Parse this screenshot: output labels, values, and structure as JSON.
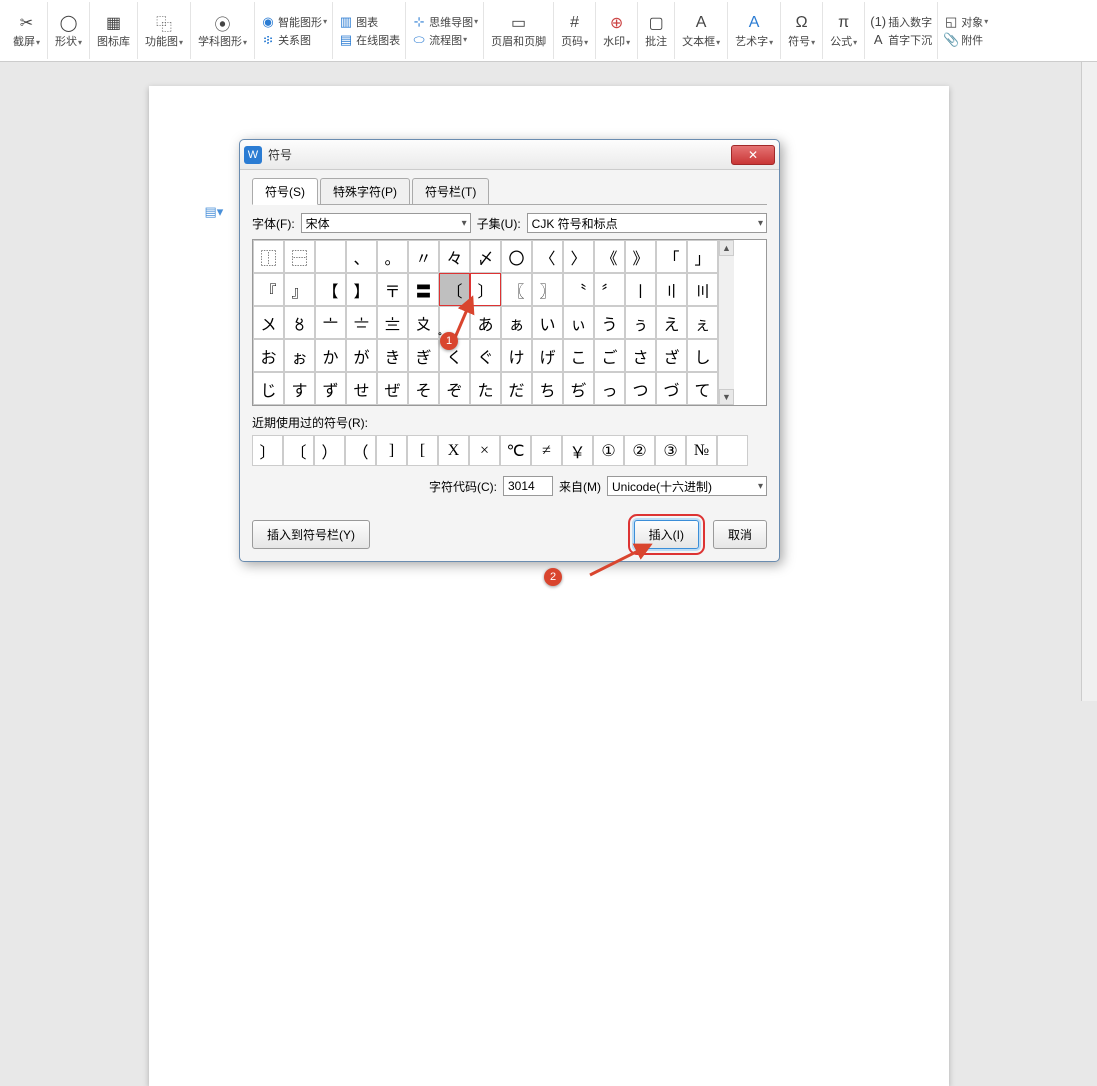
{
  "ribbon": {
    "screenshot": "截屏",
    "shape": "形状",
    "iconlib": "图标库",
    "funcimg": "功能图",
    "subjimg": "学科图形",
    "smartart": "智能图形",
    "chart": "图表",
    "relation": "关系图",
    "mindmap": "思维导图",
    "onlinechart": "在线图表",
    "flowchart": "流程图",
    "headerfooter": "页眉和页脚",
    "pagenum": "页码",
    "watermark": "水印",
    "comment": "批注",
    "textbox": "文本框",
    "wordart": "艺术字",
    "symbol": "符号",
    "equation": "公式",
    "insnum": "插入数字",
    "object": "对象",
    "dropcap": "首字下沉",
    "attach": "附件"
  },
  "dialog": {
    "title": "符号",
    "tabs": {
      "sym": "符号(S)",
      "special": "特殊字符(P)",
      "bar": "符号栏(T)"
    },
    "font_lbl": "字体(F):",
    "font_val": "宋体",
    "subset_lbl": "子集(U):",
    "subset_val": "CJK 符号和标点",
    "grid": [
      [
        "⿰",
        "⿱",
        "",
        "、",
        "。",
        "〃",
        "々",
        "〆",
        "〇",
        "〈",
        "〉",
        "《",
        "》",
        "「",
        "」"
      ],
      [
        "『",
        "』",
        "【",
        "】",
        "〒",
        "〓",
        "〔",
        "〕",
        "〖",
        "〗",
        "〝",
        "〞",
        "〡",
        "〢",
        "〣"
      ],
      [
        "〤",
        "〥",
        "〦",
        "〧",
        "〨",
        "〩",
        "〪",
        "あ",
        "ぁ",
        "い",
        "ぃ",
        "う",
        "ぅ",
        "え",
        "ぇ"
      ],
      [
        "お",
        "ぉ",
        "か",
        "が",
        "き",
        "ぎ",
        "く",
        "ぐ",
        "け",
        "げ",
        "こ",
        "ご",
        "さ",
        "ざ",
        "し"
      ],
      [
        "じ",
        "す",
        "ず",
        "せ",
        "ぜ",
        "そ",
        "ぞ",
        "た",
        "だ",
        "ち",
        "ぢ",
        "っ",
        "つ",
        "づ",
        "て"
      ]
    ],
    "sel_row": 1,
    "sel_col": 6,
    "recent_lbl": "近期使用过的符号(R):",
    "recent": [
      "〕",
      "〔",
      "）",
      "（",
      "]",
      "[",
      "X",
      "×",
      "℃",
      "≠",
      "￥",
      "①",
      "②",
      "③",
      "№",
      ""
    ],
    "code_lbl": "字符代码(C):",
    "code_val": "3014",
    "from_lbl": "来自(M)",
    "from_val": "Unicode(十六进制)",
    "insert_bar": "插入到符号栏(Y)",
    "insert": "插入(I)",
    "cancel": "取消"
  },
  "anno": {
    "one": "1",
    "two": "2"
  }
}
